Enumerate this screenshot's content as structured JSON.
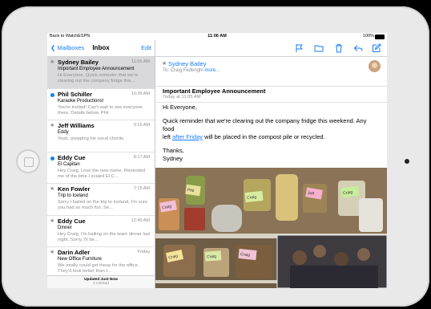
{
  "status": {
    "back_app": "Back to WatchESPN",
    "time": "11:06 AM",
    "battery": "100%"
  },
  "list_nav": {
    "back": "Mailboxes",
    "title": "Inbox",
    "edit": "Edit"
  },
  "messages": [
    {
      "sender": "Sydney Bailey",
      "time": "11:05 AM",
      "subject": "Important Employee Announcement",
      "preview": "Hi Everyone, Quick reminder that we're clearing out the company fridge this..."
    },
    {
      "sender": "Phil Schiller",
      "time": "10:36 AM",
      "subject": "Karaoke Productions!",
      "preview": "You're invited! Can't wait to see everyone there. Details below. Phil"
    },
    {
      "sender": "Jeff Williams",
      "time": "9:16 AM",
      "subject": "Eddy",
      "preview": "Yeah, prepping his vocal chords."
    },
    {
      "sender": "Eddy Cue",
      "time": "8:17 AM",
      "subject": "El Capitan",
      "preview": "Hey Craig, Love the new name. Reminded me of the time I scaled El C..."
    },
    {
      "sender": "Ken Fowler",
      "time": "7:15 AM",
      "subject": "Trip to Iceland",
      "preview": "Sorry I bailed on the trip to Iceland, I'm sure you had so much fun. Se..."
    },
    {
      "sender": "Eddy Cue",
      "time": "12:40 AM",
      "subject": "Dinner",
      "preview": "Hey Craig, I'm bailing on the team dinner last night. Sorry, I'll be..."
    },
    {
      "sender": "Darin Adler",
      "time": "Friday",
      "subject": "New Office Furniture",
      "preview": "We totally could get these for the office. They'd look better than t..."
    }
  ],
  "list_footer": {
    "updated": "Updated Just Now",
    "unread": "2 Unread"
  },
  "mail": {
    "from": "Sydney Bailey",
    "to_prefix": "To:",
    "to": "Craig Federighi",
    "more": "more...",
    "subject": "Important Employee Announcement",
    "date": "Today at 11:05 AM",
    "greeting": "Hi Everyone,",
    "line1": "Quick reminder that we're clearing out the company fridge this weekend. Any food",
    "line2_pre": "left",
    "line2_link": "after Friday",
    "line2_post": "will be placed in the compost pile or recycled.",
    "thanks": "Thanks,",
    "sign": "Sydney"
  },
  "photo_labels": [
    "Craig",
    "Phil",
    "Craig",
    "Jeff",
    "Craig",
    "Craig",
    "Craig",
    "Craig"
  ],
  "icons": [
    "flag-icon",
    "folder-icon",
    "trash-icon",
    "reply-icon",
    "compose-icon"
  ],
  "colors": {
    "accent": "#147efb",
    "unread_dot": "#147efb",
    "selected_row": "#d9d9dc"
  }
}
